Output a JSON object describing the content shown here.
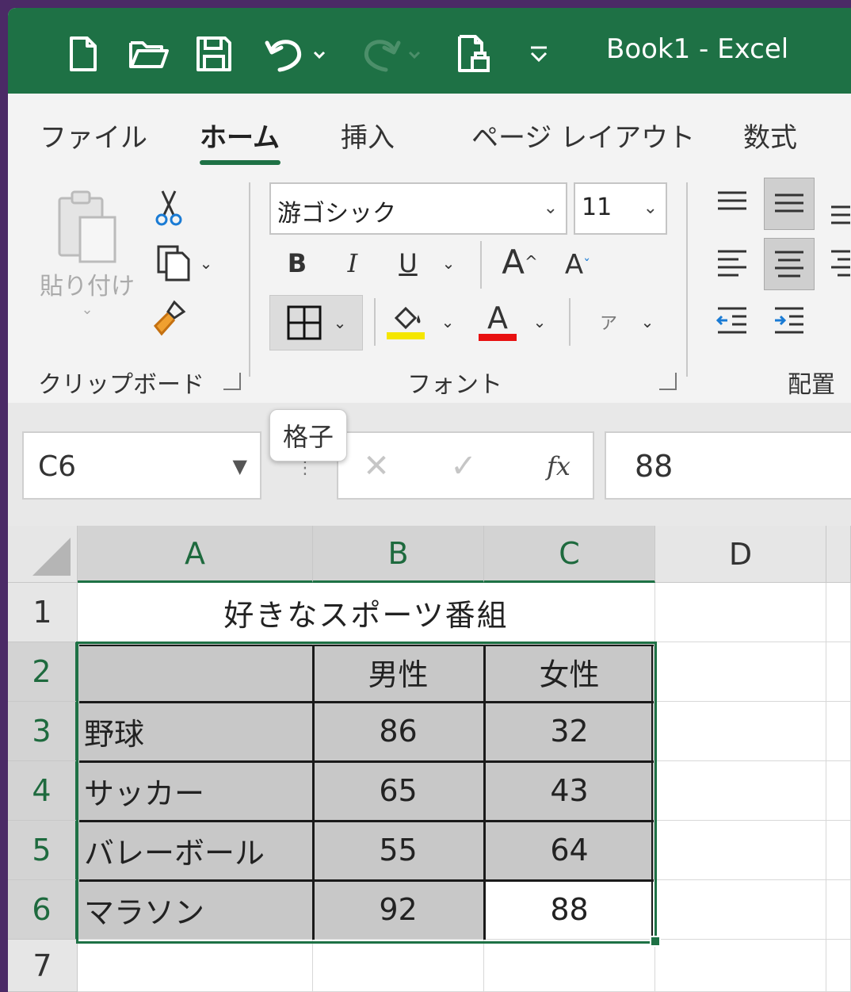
{
  "window": {
    "title": "Book1  -  Excel"
  },
  "quick_access": {
    "icons": [
      "new-file-icon",
      "open-folder-icon",
      "save-icon",
      "undo-icon",
      "redo-icon",
      "print-preview-icon",
      "customize-dropdown-icon"
    ]
  },
  "ribbon": {
    "tabs": [
      {
        "label": "ファイル",
        "active": false
      },
      {
        "label": "ホーム",
        "active": true
      },
      {
        "label": "挿入",
        "active": false
      },
      {
        "label": "ページ レイアウト",
        "active": false
      },
      {
        "label": "数式",
        "active": false
      }
    ],
    "clipboard": {
      "group_label": "クリップボード",
      "paste_label": "貼り付け"
    },
    "font": {
      "group_label": "フォント",
      "font_name": "游ゴシック",
      "font_size": "11",
      "bold": "B",
      "italic": "I",
      "underline": "U",
      "grow_font": "A",
      "shrink_font": "A",
      "font_color_letter": "A",
      "phonetic": "ア",
      "fill_color": "#f5e600",
      "font_color": "#e81010"
    },
    "alignment": {
      "group_label": "配置"
    }
  },
  "tooltip": {
    "text": "格子"
  },
  "formula_bar": {
    "name_box": "C6",
    "fx": "fx",
    "value": "88"
  },
  "sheet": {
    "columns": [
      "A",
      "B",
      "C",
      "D"
    ],
    "rows": [
      "1",
      "2",
      "3",
      "4",
      "5",
      "6",
      "7"
    ],
    "title": "好きなスポーツ番組",
    "header": [
      "",
      "男性",
      "女性"
    ],
    "data": [
      {
        "label": "野球",
        "male": "86",
        "female": "32"
      },
      {
        "label": "サッカー",
        "male": "65",
        "female": "43"
      },
      {
        "label": "バレーボール",
        "male": "55",
        "female": "64"
      },
      {
        "label": "マラソン",
        "male": "92",
        "female": "88"
      }
    ],
    "active_cell": "C6",
    "accent_color": "#1e7145"
  }
}
